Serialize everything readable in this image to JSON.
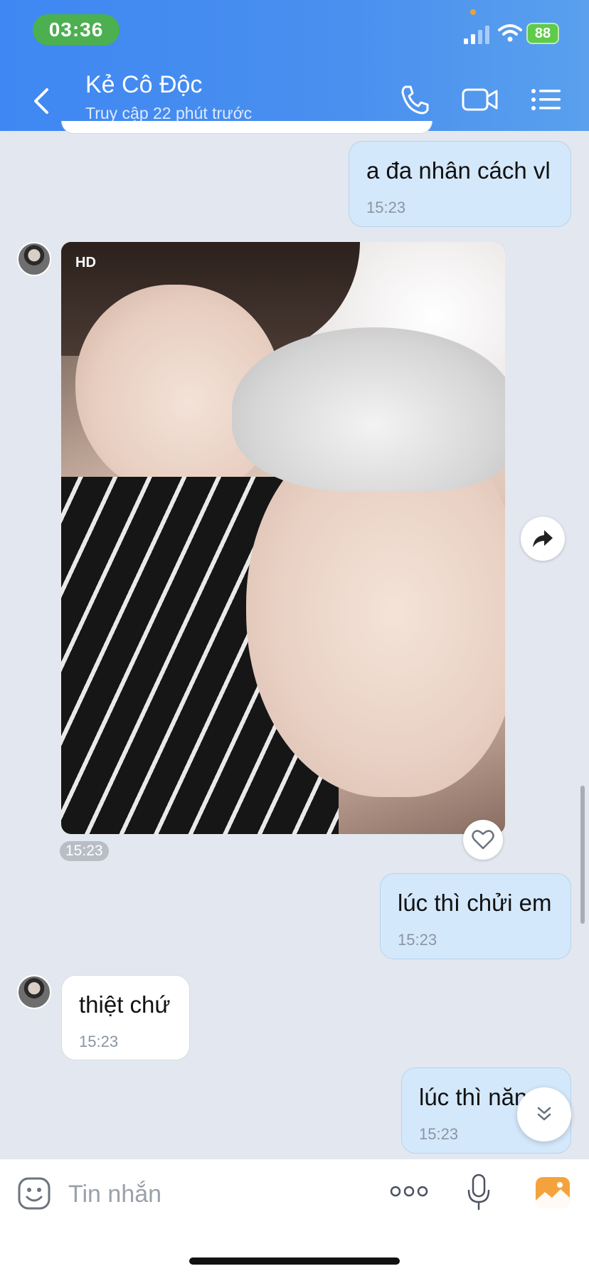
{
  "status_bar": {
    "time": "03:36",
    "battery": "88"
  },
  "header": {
    "contact_name": "Kẻ Cô Độc",
    "contact_status": "Truy cập 22 phút trước"
  },
  "messages": [
    {
      "direction": "sent",
      "text": "a đa nhân cách vl",
      "time": "15:23"
    },
    {
      "direction": "received",
      "type": "image",
      "badge": "HD",
      "time": "15:23"
    },
    {
      "direction": "sent",
      "text": "lúc thì chửi em",
      "time": "15:23"
    },
    {
      "direction": "received",
      "text": "thiệt chứ",
      "time": "15:23"
    },
    {
      "direction": "sent",
      "text": "lúc thì năn",
      "time": "15:23"
    }
  ],
  "composer": {
    "placeholder": "Tin nhắn"
  },
  "colors": {
    "header_blue": "#4a90ef",
    "sent_bubble": "#d4e8fb",
    "received_bubble": "#ffffff",
    "chat_background": "#e3e7ef",
    "time_badge_green": "#4caf50"
  },
  "icons": {
    "back": "chevron-left-icon",
    "call": "phone-icon",
    "video": "video-camera-icon",
    "menu": "list-icon",
    "share": "forward-arrow-icon",
    "like": "heart-icon",
    "scroll": "double-chevron-down-icon",
    "emoji": "emoji-icon",
    "more": "more-dots-icon",
    "mic": "microphone-icon",
    "gallery": "gallery-icon"
  }
}
